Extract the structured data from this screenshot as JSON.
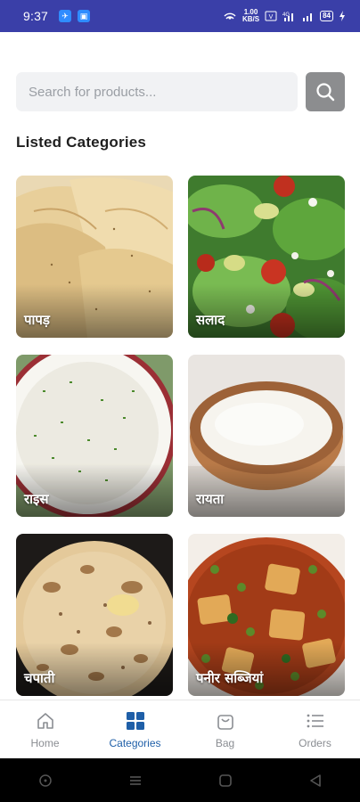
{
  "status_bar": {
    "time": "9:37",
    "speed_top": "1.00",
    "speed_bottom": "KB/S",
    "battery": "84"
  },
  "search": {
    "placeholder": "Search for products..."
  },
  "section_title": "Listed Categories",
  "categories": [
    {
      "label": "पापड़"
    },
    {
      "label": "सलाद"
    },
    {
      "label": "राइस"
    },
    {
      "label": "रायता"
    },
    {
      "label": "चपाती"
    },
    {
      "label": "पनीर सब्जियां"
    }
  ],
  "nav": {
    "home": "Home",
    "categories": "Categories",
    "bag": "Bag",
    "orders": "Orders"
  },
  "colors": {
    "status_bar": "#3a3fa8",
    "active_nav": "#1f5fa8",
    "inactive_nav": "#8a8d92"
  }
}
